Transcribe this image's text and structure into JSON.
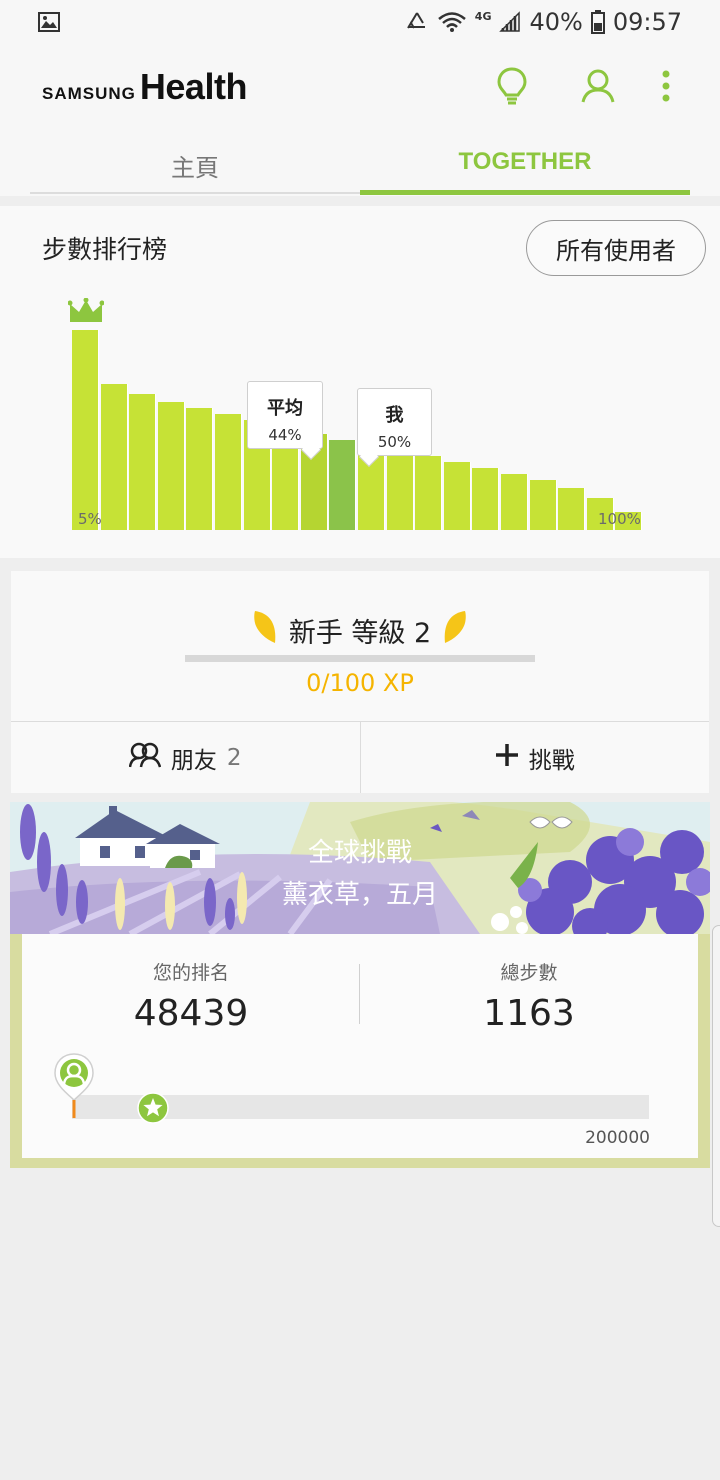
{
  "status_bar": {
    "battery": "40%",
    "time": "09:57",
    "network": "4G"
  },
  "app": {
    "brand_samsung": "SAMSUNG",
    "brand_health": "Health",
    "accent": "#8dc63f"
  },
  "tabs": [
    {
      "label": "主頁",
      "active": false
    },
    {
      "label": "TOGETHER",
      "active": true
    }
  ],
  "leaderboard": {
    "title": "步數排行榜",
    "filter_button": "所有使用者",
    "avg_label": "平均",
    "avg_value": "44%",
    "me_label": "我",
    "me_value": "50%",
    "left_label": "5%",
    "right_label": "100%"
  },
  "chart_data": {
    "type": "bar",
    "categories": [
      "5%",
      "10%",
      "15%",
      "20%",
      "25%",
      "30%",
      "35%",
      "40%",
      "45%",
      "50%",
      "55%",
      "60%",
      "65%",
      "70%",
      "75%",
      "80%",
      "85%",
      "90%",
      "95%",
      "100%"
    ],
    "values": [
      100,
      73,
      68,
      64,
      61,
      58,
      55,
      52,
      48,
      45,
      43,
      40,
      37,
      34,
      31,
      28,
      25,
      21,
      16,
      9
    ],
    "highlight_average_index": 8,
    "highlight_me_index": 9,
    "colors": {
      "bar": "#c6e236",
      "average": "#b5d531",
      "me": "#8bc34a"
    }
  },
  "level": {
    "title": "新手 等級 2",
    "xp_text": "0/100 XP",
    "xp_progress": 0,
    "friends_label": "朋友",
    "friends_count": "2",
    "challenge_label": "挑戰"
  },
  "challenge": {
    "title": "全球挑戰",
    "subtitle": "薰衣草，五月",
    "rank_label": "您的排名",
    "rank_value": "48439",
    "steps_label": "總步數",
    "steps_value": "1163",
    "goal_label": "200000",
    "progress": 0.0058
  },
  "icons": [
    "image-icon",
    "wifi-icon",
    "signal-icon",
    "battery-icon",
    "lightbulb-icon",
    "profile-icon",
    "more-icon",
    "crown-icon",
    "friends-icon",
    "plus-icon",
    "star-icon",
    "avatar-pin-icon"
  ]
}
